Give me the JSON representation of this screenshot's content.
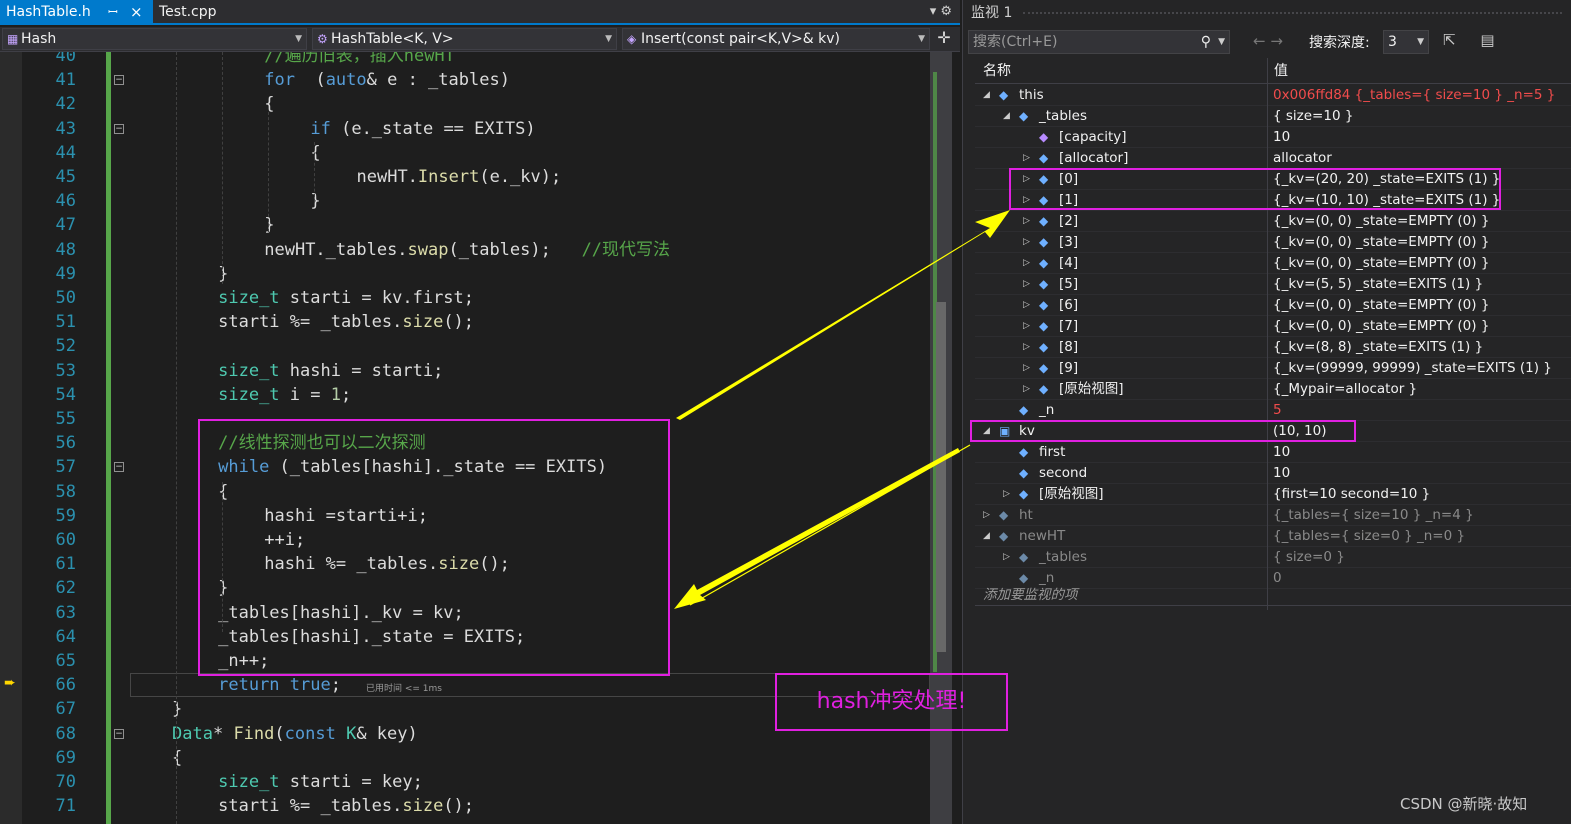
{
  "tabs": [
    {
      "label": "HashTable.h",
      "pin": "ꟷ",
      "close": "×",
      "active": true
    },
    {
      "label": "Test.cpp",
      "active": false
    }
  ],
  "tab_tools": "▾ ⚙",
  "nav": {
    "project": "Hash",
    "scope": "HashTable<K, V>",
    "member": "Insert(const pair<K,V>& kv)",
    "split": "✛"
  },
  "code": [
    {
      "n": "40",
      "tokens": [
        [
          "cm",
          "//遍历旧表，插入newHT"
        ]
      ],
      "indent": 8
    },
    {
      "n": "41",
      "tokens": [
        [
          "kw",
          "for"
        ],
        [
          "",
          "  ("
        ],
        [
          "kw",
          "auto"
        ],
        [
          "",
          "& e : _tables)"
        ]
      ],
      "indent": 8
    },
    {
      "n": "42",
      "tokens": [
        [
          "",
          "{"
        ]
      ],
      "indent": 8
    },
    {
      "n": "43",
      "tokens": [
        [
          "kw",
          "if"
        ],
        [
          "",
          " (e._state == "
        ],
        [
          "mb",
          "EXITS"
        ],
        [
          "",
          ")"
        ]
      ],
      "indent": 12
    },
    {
      "n": "44",
      "tokens": [
        [
          "",
          "{"
        ]
      ],
      "indent": 12
    },
    {
      "n": "45",
      "tokens": [
        [
          "",
          "newHT."
        ],
        [
          "fn",
          "Insert"
        ],
        [
          "",
          "(e._kv);"
        ]
      ],
      "indent": 16
    },
    {
      "n": "46",
      "tokens": [
        [
          "",
          "}"
        ]
      ],
      "indent": 12
    },
    {
      "n": "47",
      "tokens": [
        [
          "",
          "}"
        ]
      ],
      "indent": 8
    },
    {
      "n": "48",
      "tokens": [
        [
          "",
          "newHT._tables."
        ],
        [
          "fn",
          "swap"
        ],
        [
          "",
          "(_tables);   "
        ],
        [
          "cm",
          "//现代写法"
        ]
      ],
      "indent": 8
    },
    {
      "n": "49",
      "tokens": [
        [
          "",
          "}"
        ]
      ],
      "indent": 4
    },
    {
      "n": "50",
      "tokens": [
        [
          "ty",
          "size_t"
        ],
        [
          "",
          " starti = kv.first;"
        ]
      ],
      "indent": 4
    },
    {
      "n": "51",
      "tokens": [
        [
          "",
          "starti %= _tables."
        ],
        [
          "fn",
          "size"
        ],
        [
          "",
          "();"
        ]
      ],
      "indent": 4
    },
    {
      "n": "52",
      "tokens": [
        [
          "",
          ""
        ]
      ],
      "indent": 4
    },
    {
      "n": "53",
      "tokens": [
        [
          "ty",
          "size_t"
        ],
        [
          "",
          " hashi = starti;"
        ]
      ],
      "indent": 4
    },
    {
      "n": "54",
      "tokens": [
        [
          "ty",
          "size_t"
        ],
        [
          "",
          " i = "
        ],
        [
          "num",
          "1"
        ],
        [
          "",
          ";"
        ]
      ],
      "indent": 4
    },
    {
      "n": "55",
      "tokens": [
        [
          "",
          ""
        ]
      ],
      "indent": 4
    },
    {
      "n": "56",
      "tokens": [
        [
          "cm",
          "//线性探测也可以二次探测"
        ]
      ],
      "indent": 4
    },
    {
      "n": "57",
      "tokens": [
        [
          "kw",
          "while"
        ],
        [
          "",
          " (_tables[hashi]._state == "
        ],
        [
          "mb",
          "EXITS"
        ],
        [
          "",
          ")"
        ]
      ],
      "indent": 4
    },
    {
      "n": "58",
      "tokens": [
        [
          "",
          "{"
        ]
      ],
      "indent": 4
    },
    {
      "n": "59",
      "tokens": [
        [
          "",
          "hashi =starti+i;"
        ]
      ],
      "indent": 8
    },
    {
      "n": "60",
      "tokens": [
        [
          "",
          "++i;"
        ]
      ],
      "indent": 8
    },
    {
      "n": "61",
      "tokens": [
        [
          "",
          "hashi %= _tables."
        ],
        [
          "fn",
          "size"
        ],
        [
          "",
          "();"
        ]
      ],
      "indent": 8
    },
    {
      "n": "62",
      "tokens": [
        [
          "",
          "}"
        ]
      ],
      "indent": 4
    },
    {
      "n": "63",
      "tokens": [
        [
          "",
          "_tables[hashi]._kv = kv;"
        ]
      ],
      "indent": 4
    },
    {
      "n": "64",
      "tokens": [
        [
          "",
          "_tables[hashi]._state = "
        ],
        [
          "mb",
          "EXITS"
        ],
        [
          "",
          ";"
        ]
      ],
      "indent": 4
    },
    {
      "n": "65",
      "tokens": [
        [
          "",
          "_n++;"
        ]
      ],
      "indent": 4
    },
    {
      "n": "66",
      "tokens": [
        [
          "kw",
          "return"
        ],
        [
          "",
          " "
        ],
        [
          "kw",
          "true"
        ],
        [
          "",
          ";"
        ]
      ],
      "indent": 4
    },
    {
      "n": "67",
      "tokens": [
        [
          "",
          "}"
        ]
      ],
      "indent": 0
    },
    {
      "n": "68",
      "tokens": [
        [
          "ty",
          "Data"
        ],
        [
          "",
          "* "
        ],
        [
          "fn",
          "Find"
        ],
        [
          "",
          "("
        ],
        [
          "kw",
          "const"
        ],
        [
          "",
          " "
        ],
        [
          "ty",
          "K"
        ],
        [
          "",
          "& key)"
        ]
      ],
      "indent": 0
    },
    {
      "n": "69",
      "tokens": [
        [
          "",
          "{"
        ]
      ],
      "indent": 0
    },
    {
      "n": "70",
      "tokens": [
        [
          "ty",
          "size_t"
        ],
        [
          "",
          " starti = key;"
        ]
      ],
      "indent": 4
    },
    {
      "n": "71",
      "tokens": [
        [
          "",
          "starti %= _tables."
        ],
        [
          "fn",
          "size"
        ],
        [
          "",
          "();"
        ]
      ],
      "indent": 4
    }
  ],
  "elapsed": "已用时间 <= 1ms",
  "watch": {
    "title": "监视 1",
    "search_placeholder": "搜索(Ctrl+E)",
    "search_icon": "🔍",
    "nav_arrows": "←  →",
    "depth_label": "搜索深度:",
    "depth_value": "3",
    "tool_icons": "⇱ ▤",
    "col_name": "名称",
    "col_value": "值",
    "add_item": "添加要监视的项",
    "rows": [
      {
        "name": "this",
        "value": "0x006ffd84 {_tables={ size=10 } _n=5 }",
        "level": 0,
        "exp": "◢",
        "icon": "◆",
        "vstyle": "red"
      },
      {
        "name": "_tables",
        "value": "{ size=10 }",
        "level": 1,
        "exp": "◢",
        "icon": "◆"
      },
      {
        "name": "[capacity]",
        "value": "10",
        "level": 2,
        "exp": "",
        "icon": "◆",
        "istyle": "prop"
      },
      {
        "name": "[allocator]",
        "value": "allocator",
        "level": 2,
        "exp": "▷",
        "icon": "◆"
      },
      {
        "name": "[0]",
        "value": "{_kv=(20, 20) _state=EXITS (1) }",
        "level": 2,
        "exp": "▷",
        "icon": "◆"
      },
      {
        "name": "[1]",
        "value": "{_kv=(10, 10) _state=EXITS (1) }",
        "level": 2,
        "exp": "▷",
        "icon": "◆"
      },
      {
        "name": "[2]",
        "value": "{_kv=(0, 0) _state=EMPTY (0) }",
        "level": 2,
        "exp": "▷",
        "icon": "◆"
      },
      {
        "name": "[3]",
        "value": "{_kv=(0, 0) _state=EMPTY (0) }",
        "level": 2,
        "exp": "▷",
        "icon": "◆"
      },
      {
        "name": "[4]",
        "value": "{_kv=(0, 0) _state=EMPTY (0) }",
        "level": 2,
        "exp": "▷",
        "icon": "◆"
      },
      {
        "name": "[5]",
        "value": "{_kv=(5, 5) _state=EXITS (1) }",
        "level": 2,
        "exp": "▷",
        "icon": "◆"
      },
      {
        "name": "[6]",
        "value": "{_kv=(0, 0) _state=EMPTY (0) }",
        "level": 2,
        "exp": "▷",
        "icon": "◆"
      },
      {
        "name": "[7]",
        "value": "{_kv=(0, 0) _state=EMPTY (0) }",
        "level": 2,
        "exp": "▷",
        "icon": "◆"
      },
      {
        "name": "[8]",
        "value": "{_kv=(8, 8) _state=EXITS (1) }",
        "level": 2,
        "exp": "▷",
        "icon": "◆"
      },
      {
        "name": "[9]",
        "value": "{_kv=(99999, 99999) _state=EXITS (1) }",
        "level": 2,
        "exp": "▷",
        "icon": "◆"
      },
      {
        "name": "[原始视图]",
        "value": "{_Mypair=allocator }",
        "level": 2,
        "exp": "▷",
        "icon": "◆"
      },
      {
        "name": "_n",
        "value": "5",
        "level": 1,
        "exp": "",
        "icon": "◆",
        "vstyle": "red"
      },
      {
        "name": "kv",
        "value": "(10, 10)",
        "level": 0,
        "exp": "◢",
        "icon": "▣"
      },
      {
        "name": "first",
        "value": "10",
        "level": 1,
        "exp": "",
        "icon": "◆"
      },
      {
        "name": "second",
        "value": "10",
        "level": 1,
        "exp": "",
        "icon": "◆"
      },
      {
        "name": "[原始视图]",
        "value": "{first=10 second=10 }",
        "level": 1,
        "exp": "▷",
        "icon": "◆"
      },
      {
        "name": "ht",
        "value": "{_tables={ size=10 } _n=4 }",
        "level": 0,
        "exp": "▷",
        "icon": "◆",
        "vstyle": "dim",
        "nstyle": "dim",
        "istyle": "dim"
      },
      {
        "name": "newHT",
        "value": "{_tables={ size=0 } _n=0 }",
        "level": 0,
        "exp": "◢",
        "icon": "◆",
        "vstyle": "dim",
        "nstyle": "dim",
        "istyle": "dim"
      },
      {
        "name": "_tables",
        "value": "{ size=0 }",
        "level": 1,
        "exp": "▷",
        "icon": "◆",
        "vstyle": "dim",
        "nstyle": "dim",
        "istyle": "dim"
      },
      {
        "name": "_n",
        "value": "0",
        "level": 1,
        "exp": "",
        "icon": "◆",
        "vstyle": "dim",
        "nstyle": "dim",
        "istyle": "dim"
      }
    ]
  },
  "annotation": "hash冲突处理!",
  "watermark": "CSDN @新晓·故知",
  "colors": {
    "accent": "#007acc",
    "highlight": "#e020e0",
    "arrow": "#ffff00"
  }
}
